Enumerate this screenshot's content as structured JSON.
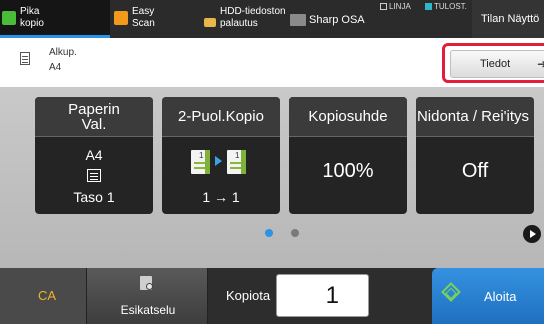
{
  "topbar": {
    "tabs": [
      {
        "label_line1": "Pika",
        "label_line2": "kopio",
        "icon": "copy-icon"
      },
      {
        "label_line1": "Easy",
        "label_line2": "Scan",
        "icon": "scan-icon"
      },
      {
        "label_line1": "HDD-tiedoston",
        "label_line2": "palautus",
        "icon": "folder-icon"
      },
      {
        "label_line1": "Sharp OSA",
        "icon": "sharp-osa-icon"
      }
    ],
    "status_line": "LINJA",
    "status_print": "TULOST.",
    "status_tab": "Tilan Näyttö"
  },
  "originals": {
    "label": "Alkup.",
    "value": "A4",
    "details_button": "Tiedot",
    "details_arrow": "➜"
  },
  "cards": {
    "paper": {
      "title_line1": "Paperin",
      "title_line2": "Val.",
      "value": "A4",
      "tray": "Taso 1",
      "icon": "paper-tray-icon"
    },
    "duplex": {
      "title": "2-Puol.Kopio",
      "value": "1 → 1",
      "icon": "duplex-copy-icon",
      "page_number": "1"
    },
    "ratio": {
      "title": "Kopiosuhde",
      "value": "100%"
    },
    "binding": {
      "title": "Nidonta / Rei'itys",
      "value": "Off"
    }
  },
  "pager": {
    "current_page": 1,
    "total_pages": 2
  },
  "bottombar": {
    "ca_label": "CA",
    "preview_label": "Esikatselu",
    "copies_label": "Kopiota",
    "copies_value": "1",
    "start_label": "Aloita"
  },
  "colors": {
    "accent": "#2a93e6",
    "highlight": "#e31e3c",
    "ca": "#f0b428",
    "start": "#2a7fd0"
  }
}
